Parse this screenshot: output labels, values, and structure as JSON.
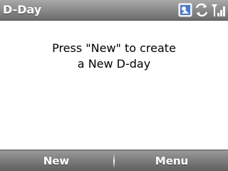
{
  "window": {
    "title": "D-Day"
  },
  "status_bar": {
    "icons": [
      "notification-icon",
      "sync-icon",
      "signal-strength-icon"
    ]
  },
  "main": {
    "message_line1": "Press \"New\" to create",
    "message_line2": "a New D-day"
  },
  "softkeys": {
    "left_label": "New",
    "right_label": "Menu"
  },
  "colors": {
    "bar_top": "#a9a9a9",
    "bar_bottom": "#6c6c6c",
    "bar_text": "#ffffff",
    "background": "#ffffff"
  }
}
